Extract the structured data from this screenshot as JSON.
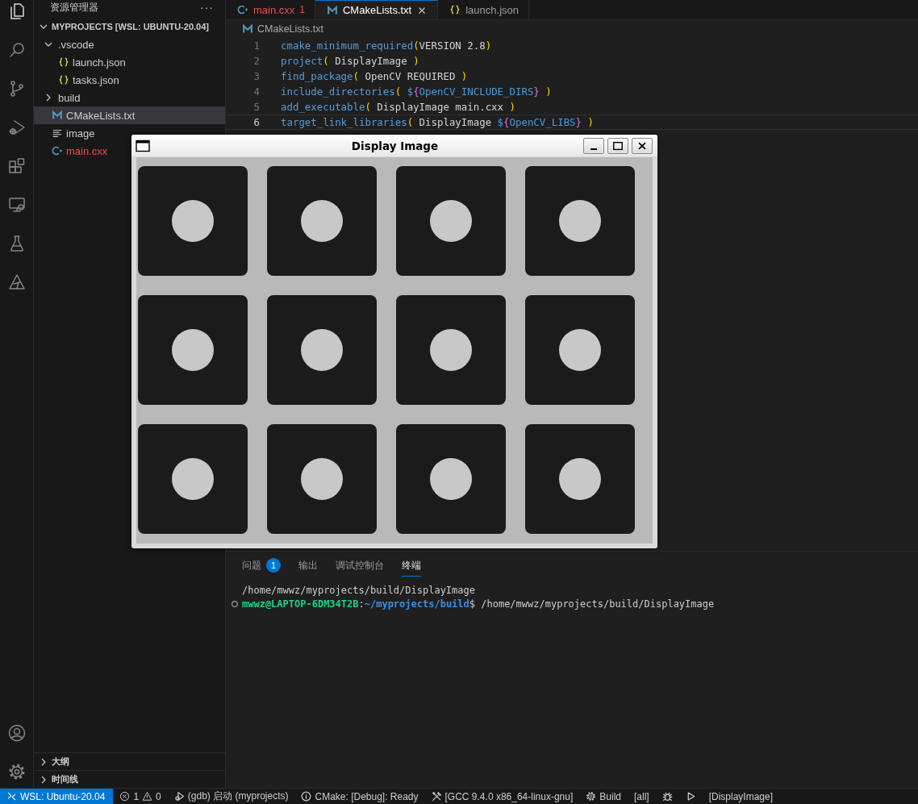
{
  "activity_bar": {
    "top": [
      {
        "selected": true
      },
      {
        "selected": false
      },
      {
        "selected": false
      },
      {
        "selected": false
      },
      {
        "selected": false
      },
      {
        "selected": false
      },
      {
        "selected": false
      },
      {
        "selected": false
      }
    ],
    "bottom": [
      {
        "selected": false
      },
      {
        "selected": false
      }
    ]
  },
  "explorer": {
    "title": "资源管理器",
    "more": "···",
    "root": {
      "label": "MYPROJECTS [WSL: UBUNTU-20.04]",
      "expanded": true
    },
    "tree": [
      {
        "label": ".vscode",
        "kind": "folder",
        "expanded": true,
        "selected": false,
        "error": false,
        "children": [
          {
            "label": "launch.json",
            "kind": "json",
            "selected": false,
            "error": false
          },
          {
            "label": "tasks.json",
            "kind": "json",
            "selected": false,
            "error": false
          }
        ]
      },
      {
        "label": "build",
        "kind": "folder",
        "expanded": false,
        "selected": false,
        "error": false
      },
      {
        "label": "CMakeLists.txt",
        "kind": "cmake",
        "selected": true,
        "error": false
      },
      {
        "label": "image",
        "kind": "text",
        "selected": false,
        "error": false
      },
      {
        "label": "main.cxx",
        "kind": "cpp",
        "selected": false,
        "error": true
      }
    ],
    "sections": [
      {
        "label": "大纲",
        "expanded": false
      },
      {
        "label": "时间线",
        "expanded": false
      }
    ]
  },
  "tabs": [
    {
      "label": "main.cxx",
      "kind": "cpp",
      "badge": "1",
      "selected": false,
      "error": true
    },
    {
      "label": "CMakeLists.txt",
      "kind": "cmake",
      "selected": true,
      "error": false
    },
    {
      "label": "launch.json",
      "kind": "json",
      "selected": false,
      "error": false
    }
  ],
  "breadcrumb": {
    "kind": "cmake",
    "label": "CMakeLists.txt"
  },
  "code": [
    {
      "number": "1",
      "current": false,
      "tokens": [
        {
          "kind": "fn",
          "text": "cmake_minimum_required"
        },
        {
          "kind": "paren",
          "text": "("
        },
        {
          "kind": "text",
          "text": "VERSION 2.8"
        },
        {
          "kind": "paren",
          "text": ")"
        }
      ]
    },
    {
      "number": "2",
      "current": false,
      "tokens": [
        {
          "kind": "fn",
          "text": "project"
        },
        {
          "kind": "paren",
          "text": "("
        },
        {
          "kind": "text",
          "text": " DisplayImage "
        },
        {
          "kind": "paren",
          "text": ")"
        }
      ]
    },
    {
      "number": "3",
      "current": false,
      "tokens": [
        {
          "kind": "fn",
          "text": "find_package"
        },
        {
          "kind": "paren",
          "text": "("
        },
        {
          "kind": "text",
          "text": " OpenCV REQUIRED "
        },
        {
          "kind": "paren",
          "text": ")"
        }
      ]
    },
    {
      "number": "4",
      "current": false,
      "tokens": [
        {
          "kind": "fn",
          "text": "include_directories"
        },
        {
          "kind": "paren",
          "text": "( "
        },
        {
          "kind": "var",
          "text": "$"
        },
        {
          "kind": "brace",
          "text": "{"
        },
        {
          "kind": "var",
          "text": "OpenCV_INCLUDE_DIRS"
        },
        {
          "kind": "brace",
          "text": "}"
        },
        {
          "kind": "paren",
          "text": " )"
        }
      ]
    },
    {
      "number": "5",
      "current": false,
      "tokens": [
        {
          "kind": "fn",
          "text": "add_executable"
        },
        {
          "kind": "paren",
          "text": "("
        },
        {
          "kind": "text",
          "text": " DisplayImage main.cxx "
        },
        {
          "kind": "paren",
          "text": ")"
        }
      ]
    },
    {
      "number": "6",
      "current": true,
      "tokens": [
        {
          "kind": "fn",
          "text": "target_link_libraries"
        },
        {
          "kind": "paren",
          "text": "("
        },
        {
          "kind": "text",
          "text": " DisplayImage "
        },
        {
          "kind": "var",
          "text": "$"
        },
        {
          "kind": "brace",
          "text": "{"
        },
        {
          "kind": "var",
          "text": "OpenCV_LIBS"
        },
        {
          "kind": "brace",
          "text": "}"
        },
        {
          "kind": "paren",
          "text": " )"
        }
      ]
    }
  ],
  "image_window": {
    "title": "Display Image"
  },
  "panel": {
    "tabs": [
      {
        "label": "问题",
        "badge": "1",
        "selected": false
      },
      {
        "label": "输出",
        "selected": false
      },
      {
        "label": "调试控制台",
        "selected": false
      },
      {
        "label": "终端",
        "selected": true
      }
    ],
    "terminal": [
      {
        "prompt": false,
        "segments": [
          {
            "kind": "output",
            "text": "/home/mwwz/myprojects/build/DisplayImage"
          }
        ]
      },
      {
        "prompt": true,
        "segments": [
          {
            "kind": "user",
            "text": "mwwz@LAPTOP-6DM34T2B"
          },
          {
            "kind": "output",
            "text": ":"
          },
          {
            "kind": "path",
            "text": "~/myprojects/build"
          },
          {
            "kind": "output",
            "text": "$ /home/mwwz/myprojects/build/DisplayImage"
          }
        ]
      }
    ]
  },
  "status_bar": [
    {
      "kind": "remote",
      "text": "WSL: Ubuntu-20.04"
    },
    {
      "kind": "problems",
      "errors": "1",
      "warnings": "0"
    },
    {
      "kind": "item",
      "text": "(gdb) 启动 (myprojects)"
    },
    {
      "kind": "item",
      "text": "CMake: [Debug]: Ready"
    },
    {
      "kind": "item",
      "text": "[GCC 9.4.0 x86_64-linux-gnu]"
    },
    {
      "kind": "item",
      "text": "Build"
    },
    {
      "kind": "item",
      "text": "[all]"
    },
    {
      "kind": "icon"
    },
    {
      "kind": "icon"
    },
    {
      "kind": "item",
      "text": "[DisplayImage]"
    }
  ]
}
